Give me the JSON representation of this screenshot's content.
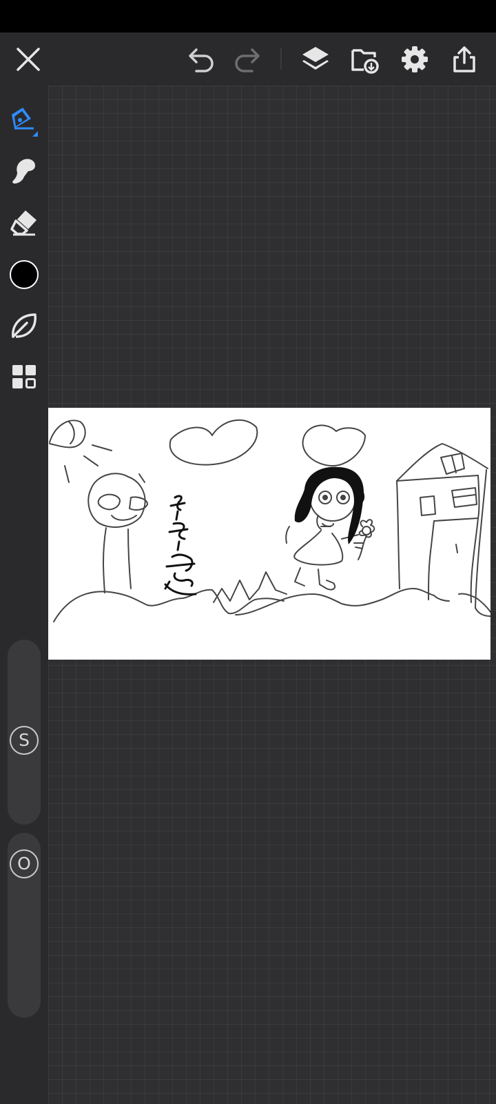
{
  "toolbar": {
    "close": "close-icon",
    "undo": "undo-icon",
    "redo": "redo-icon",
    "layers": "layers-icon",
    "import": "import-icon",
    "settings": "gear-icon",
    "share": "share-icon"
  },
  "tools": {
    "pen": "pen-icon",
    "smudge": "smudge-icon",
    "eraser": "eraser-icon",
    "color": "#000000",
    "brush_library": "leaf-icon",
    "more": "grid-icon",
    "active_color": "#2f8cff"
  },
  "sliders": {
    "size_label": "S",
    "opacity_label": "O"
  },
  "canvas": {
    "background": "#ffffff"
  }
}
